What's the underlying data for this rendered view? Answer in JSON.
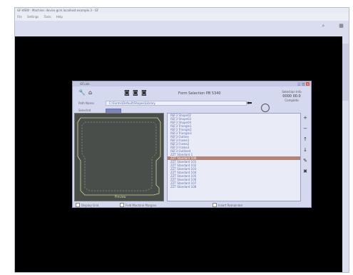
{
  "window": {
    "title": "GF-VIEW - Machine: device.gcm.localhost.example.3 - GF",
    "menus": [
      "File",
      "Settings",
      "Tools",
      "Help"
    ]
  },
  "toolstrip": {
    "icons": [
      "search-icon",
      "grid-icon"
    ]
  },
  "dialog": {
    "title": "GFLink",
    "icons": [
      "wrench-icon",
      "home-icon",
      "camera-icon",
      "camera-icon",
      "camera-icon"
    ],
    "name": "Form Selection PB 5340",
    "info_label": "Selection Info",
    "info_value": "0000 00.0",
    "info_sub": "Complete",
    "field1_label": "Path Name",
    "field1_value": "C:\\Forms\\Default\\Shapes\\Library",
    "field2_label": "Selected",
    "canvas_label": "Preview",
    "list": {
      "items": [
        "REF3 Shape02",
        "REF3 Shape03",
        "REF3 Shape04",
        "REF3 Triangle1",
        "REF3 Triangle2",
        "REF3 Triangle3",
        "REF3 Outline",
        "REF3 Frame1",
        "REF3 Frame2",
        "REF3 Frame3",
        "REF3 Outline4",
        "ZZT Standard 1",
        "ZZT Standard 100",
        "ZZT Standard 101",
        "ZZT Standard 102",
        "ZZT Standard 103",
        "ZZT Standard 104",
        "ZZT Standard 105",
        "ZZT Standard 106",
        "ZZT Standard 107",
        "ZZT Standard 108"
      ],
      "selected_index": 12
    },
    "side_buttons": [
      "+",
      "−",
      "↑",
      "↓",
      "✎",
      "✖"
    ],
    "status": [
      "Display Grid",
      "Fold Machine Margins",
      "Insert Remainder"
    ]
  }
}
